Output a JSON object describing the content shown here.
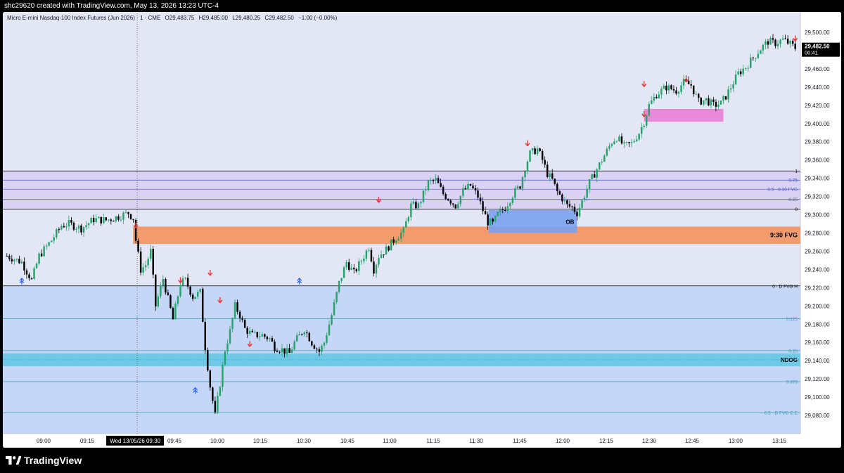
{
  "topbar": {
    "credit": "shc29620 created with TradingView.com, May 13, 2026 13:23 UTC-4"
  },
  "legend": {
    "symbol": "Micro E-mini Nasdaq-100 Index Futures (Jun 2026) · 1 · CME",
    "open": "O29,483.75",
    "high": "H29,485.00",
    "low": "L29,480.25",
    "close": "C29,482.50",
    "change": "−1.00 (−0.00%)"
  },
  "last_price": {
    "price": "29,482.50",
    "countdown": "00:41"
  },
  "crosshair_time_label": "Wed 13/05/26  09:30",
  "brand": {
    "name": "TradingView"
  },
  "colors": {
    "bg": "#e3e6f5",
    "lower_zone": "#c6d6f6",
    "upper_zone": "#d9d2f3",
    "orange_fvg": "#f49b6e",
    "blue_ob": "#7aa1f0",
    "pink_zone": "#e88ad8",
    "cyan_ndog": "#6ec9e6",
    "bull": "#26a36b",
    "bear": "#000000",
    "arrow_down": "#e53935",
    "arrow_up": "#2962ff"
  },
  "chart_data": {
    "type": "candlestick",
    "ylim": [
      29060,
      29510
    ],
    "x_ticks": [
      "09:00",
      "09:15",
      "09:45",
      "10:00",
      "10:15",
      "10:30",
      "10:45",
      "11:00",
      "11:15",
      "11:30",
      "11:45",
      "12:00",
      "12:15",
      "12:30",
      "12:45",
      "13:00",
      "13:15"
    ],
    "y_ticks": [
      "29,500.00",
      "29,480.00",
      "29,460.00",
      "29,440.00",
      "29,420.00",
      "29,400.00",
      "29,380.00",
      "29,360.00",
      "29,340.00",
      "29,320.00",
      "29,300.00",
      "29,280.00",
      "29,260.00",
      "29,240.00",
      "29,220.00",
      "29,200.00",
      "29,180.00",
      "29,160.00",
      "29,140.00",
      "29,120.00",
      "29,100.00",
      "29,080.00"
    ],
    "zones": [
      {
        "label": "",
        "top": 29222,
        "bottom": 29058,
        "kind": "lower_zone"
      },
      {
        "label": "",
        "top": 29348,
        "bottom": 29306,
        "kind": "upper_zone"
      },
      {
        "label": "9:30 FVG",
        "top": 29287,
        "bottom": 29268,
        "kind": "orange_fvg"
      },
      {
        "label": "OB",
        "top": 29305,
        "bottom": 29280,
        "kind": "blue_ob"
      },
      {
        "label": "",
        "top": 29416,
        "bottom": 29402,
        "kind": "pink_zone"
      },
      {
        "label": "NDOG",
        "top": 29148,
        "bottom": 29134,
        "kind": "cyan_ndog"
      }
    ],
    "levels": [
      {
        "label": "1",
        "price": 29348
      },
      {
        "label": "0.75",
        "price": 29338
      },
      {
        "label": "0.5 · 8:30 FVG",
        "price": 29328
      },
      {
        "label": "0.25",
        "price": 29317
      },
      {
        "label": "0",
        "price": 29306
      },
      {
        "label": "0 · D FVG H",
        "price": 29222
      },
      {
        "label": "0.125",
        "price": 29186
      },
      {
        "label": "0.25",
        "price": 29151
      },
      {
        "label": "0.375",
        "price": 29117
      },
      {
        "label": "0.5 · D FVG C.E",
        "price": 29083
      }
    ],
    "path": [
      [
        0,
        29255
      ],
      [
        6,
        29248
      ],
      [
        10,
        29228
      ],
      [
        13,
        29255
      ],
      [
        18,
        29272
      ],
      [
        22,
        29288
      ],
      [
        25,
        29290
      ],
      [
        30,
        29285
      ],
      [
        35,
        29295
      ],
      [
        40,
        29294
      ],
      [
        45,
        29298
      ],
      [
        49,
        29302
      ],
      [
        51,
        29296
      ],
      [
        52,
        29272
      ],
      [
        54,
        29240
      ],
      [
        56,
        29245
      ],
      [
        58,
        29260
      ],
      [
        60,
        29200
      ],
      [
        63,
        29230
      ],
      [
        67,
        29185
      ],
      [
        70,
        29225
      ],
      [
        72,
        29228
      ],
      [
        75,
        29210
      ],
      [
        78,
        29215
      ],
      [
        80,
        29155
      ],
      [
        82,
        29112
      ],
      [
        84,
        29080
      ],
      [
        86,
        29115
      ],
      [
        88,
        29152
      ],
      [
        90,
        29172
      ],
      [
        92,
        29200
      ],
      [
        94,
        29190
      ],
      [
        96,
        29175
      ],
      [
        99,
        29168
      ],
      [
        103,
        29168
      ],
      [
        106,
        29164
      ],
      [
        108,
        29155
      ],
      [
        111,
        29152
      ],
      [
        114,
        29148
      ],
      [
        116,
        29160
      ],
      [
        120,
        29175
      ],
      [
        123,
        29160
      ],
      [
        126,
        29150
      ],
      [
        128,
        29160
      ],
      [
        131,
        29190
      ],
      [
        134,
        29225
      ],
      [
        137,
        29248
      ],
      [
        140,
        29236
      ],
      [
        143,
        29250
      ],
      [
        146,
        29265
      ],
      [
        148,
        29240
      ],
      [
        150,
        29255
      ],
      [
        153,
        29262
      ],
      [
        157,
        29275
      ],
      [
        160,
        29282
      ],
      [
        163,
        29310
      ],
      [
        166,
        29310
      ],
      [
        170,
        29335
      ],
      [
        173,
        29338
      ],
      [
        176,
        29323
      ],
      [
        178,
        29318
      ],
      [
        181,
        29310
      ],
      [
        184,
        29326
      ],
      [
        187,
        29332
      ],
      [
        190,
        29320
      ],
      [
        192,
        29305
      ],
      [
        194,
        29292
      ],
      [
        196,
        29290
      ],
      [
        198,
        29300
      ],
      [
        201,
        29308
      ],
      [
        204,
        29322
      ],
      [
        207,
        29332
      ],
      [
        209,
        29352
      ],
      [
        211,
        29367
      ],
      [
        214,
        29372
      ],
      [
        216,
        29360
      ],
      [
        218,
        29345
      ],
      [
        220,
        29338
      ],
      [
        222,
        29325
      ],
      [
        224,
        29318
      ],
      [
        226,
        29310
      ],
      [
        228,
        29308
      ],
      [
        230,
        29302
      ],
      [
        232,
        29315
      ],
      [
        235,
        29335
      ],
      [
        238,
        29350
      ],
      [
        241,
        29365
      ],
      [
        244,
        29380
      ],
      [
        246,
        29385
      ],
      [
        249,
        29375
      ],
      [
        252,
        29378
      ],
      [
        255,
        29390
      ],
      [
        257,
        29402
      ],
      [
        259,
        29420
      ],
      [
        262,
        29432
      ],
      [
        266,
        29440
      ],
      [
        270,
        29436
      ],
      [
        273,
        29445
      ],
      [
        276,
        29442
      ],
      [
        279,
        29424
      ],
      [
        282,
        29426
      ],
      [
        285,
        29420
      ],
      [
        288,
        29422
      ],
      [
        290,
        29430
      ],
      [
        292,
        29440
      ],
      [
        295,
        29455
      ],
      [
        298,
        29462
      ],
      [
        301,
        29472
      ],
      [
        304,
        29482
      ],
      [
        307,
        29490
      ],
      [
        310,
        29488
      ],
      [
        313,
        29492
      ],
      [
        316,
        29487
      ],
      [
        318,
        29483
      ]
    ],
    "signals": [
      {
        "type": "down",
        "idx": 52,
        "price": 29290
      },
      {
        "type": "down",
        "idx": 70,
        "price": 29230
      },
      {
        "type": "down",
        "idx": 82,
        "price": 29238
      },
      {
        "type": "down",
        "idx": 86,
        "price": 29208
      },
      {
        "type": "down",
        "idx": 98,
        "price": 29160
      },
      {
        "type": "down",
        "idx": 150,
        "price": 29318
      },
      {
        "type": "down",
        "idx": 210,
        "price": 29380
      },
      {
        "type": "down",
        "idx": 257,
        "price": 29445
      },
      {
        "type": "down",
        "idx": 257,
        "price": 29412
      },
      {
        "type": "down",
        "idx": 274,
        "price": 29450
      },
      {
        "type": "down",
        "idx": 318,
        "price": 29495
      },
      {
        "type": "up",
        "idx": 6,
        "price": 29226
      },
      {
        "type": "up",
        "idx": 76,
        "price": 29106
      },
      {
        "type": "up",
        "idx": 118,
        "price": 29226
      }
    ]
  }
}
